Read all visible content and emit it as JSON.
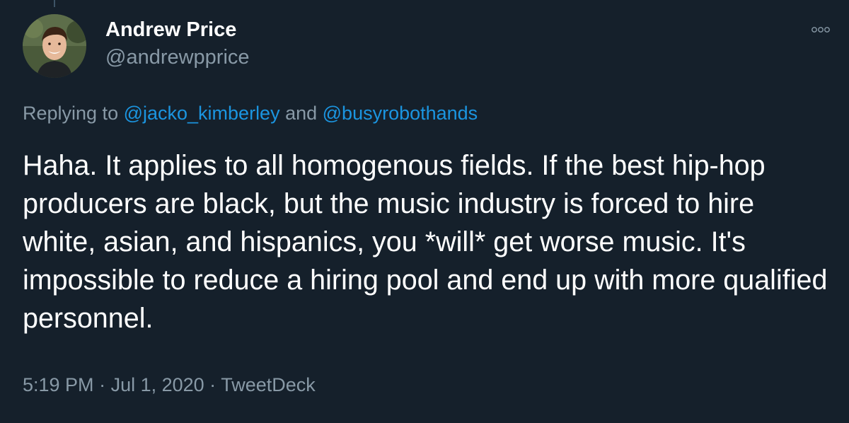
{
  "author": {
    "name": "Andrew Price",
    "handle": "@andrewpprice"
  },
  "reply": {
    "prefix": "Replying to ",
    "mention1": "@jacko_kimberley",
    "conjunction": " and ",
    "mention2": "@busyrobothands"
  },
  "tweet": {
    "text": "Haha. It applies to all homogenous fields. If the best hip-hop producers are black, but the music industry is forced to hire white, asian, and hispanics, you *will* get worse music. It's impossible to reduce a hiring pool and end up with more qualified personnel."
  },
  "meta": {
    "time": "5:19 PM",
    "separator": " · ",
    "date": "Jul 1, 2020",
    "source": "TweetDeck"
  },
  "icons": {
    "more": "more-horizontal-icon"
  },
  "colors": {
    "background": "#15202b",
    "primary_text": "#ffffff",
    "secondary_text": "#8899a6",
    "link": "#1b95e0"
  }
}
